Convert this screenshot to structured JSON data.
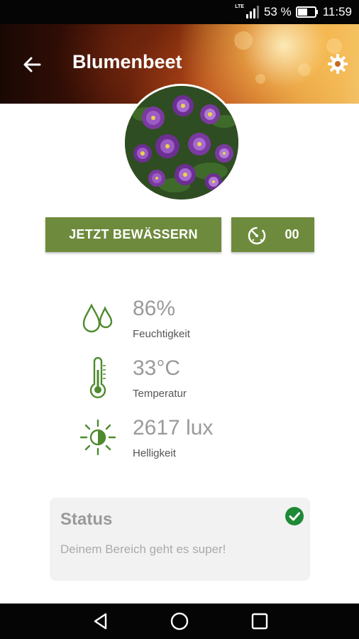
{
  "status_bar": {
    "network": "LTE",
    "battery_percent": "53 %",
    "time": "11:59",
    "icons": [
      "signal-icon",
      "battery-icon"
    ]
  },
  "header": {
    "title": "Blumenbeet",
    "back_icon": "arrow-left-icon",
    "settings_icon": "gear-icon"
  },
  "actions": {
    "water_button_label": "JETZT BEWÄSSERN",
    "timer_icon": "timer-icon",
    "timer_value": "00"
  },
  "stats": [
    {
      "icon": "water-drops-icon",
      "value": "86%",
      "label": "Feuchtigkeit"
    },
    {
      "icon": "thermometer-icon",
      "value": "33°C",
      "label": "Temperatur"
    },
    {
      "icon": "brightness-icon",
      "value": "2617 lux",
      "label": "Helligkeit"
    }
  ],
  "status": {
    "title": "Status",
    "message": "Deinem Bereich geht es super!",
    "icon": "check-circle-icon",
    "color": "#1e8a36"
  },
  "colors": {
    "accent": "#6e8b3d",
    "icon_green": "#4e8a2e"
  },
  "nav": {
    "icons": [
      "back-triangle-icon",
      "home-circle-icon",
      "recents-square-icon"
    ]
  }
}
